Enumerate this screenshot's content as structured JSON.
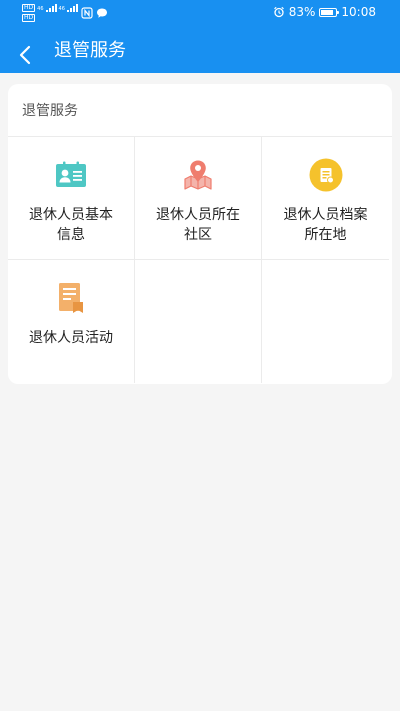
{
  "status_bar": {
    "hd_label": "HD",
    "network_1": "46",
    "network_2": "46",
    "battery_percent": "83%",
    "battery_level": 0.83,
    "time": "10:08"
  },
  "nav": {
    "title": "退管服务",
    "back_icon": "chevron-left-icon"
  },
  "section": {
    "title": "退管服务",
    "items": [
      {
        "label": "退休人员基本信息",
        "icon": "id-card-icon",
        "color": "#4ec7c4"
      },
      {
        "label": "退休人员所在社区",
        "icon": "map-pin-icon",
        "color": "#ef7d6e"
      },
      {
        "label": "退休人员档案所在地",
        "icon": "archive-icon",
        "color": "#f5c22c"
      },
      {
        "label": "退休人员活动",
        "icon": "document-icon",
        "color": "#f3b06a"
      }
    ]
  },
  "colors": {
    "header": "#1890f1",
    "background": "#f5f5f5"
  }
}
